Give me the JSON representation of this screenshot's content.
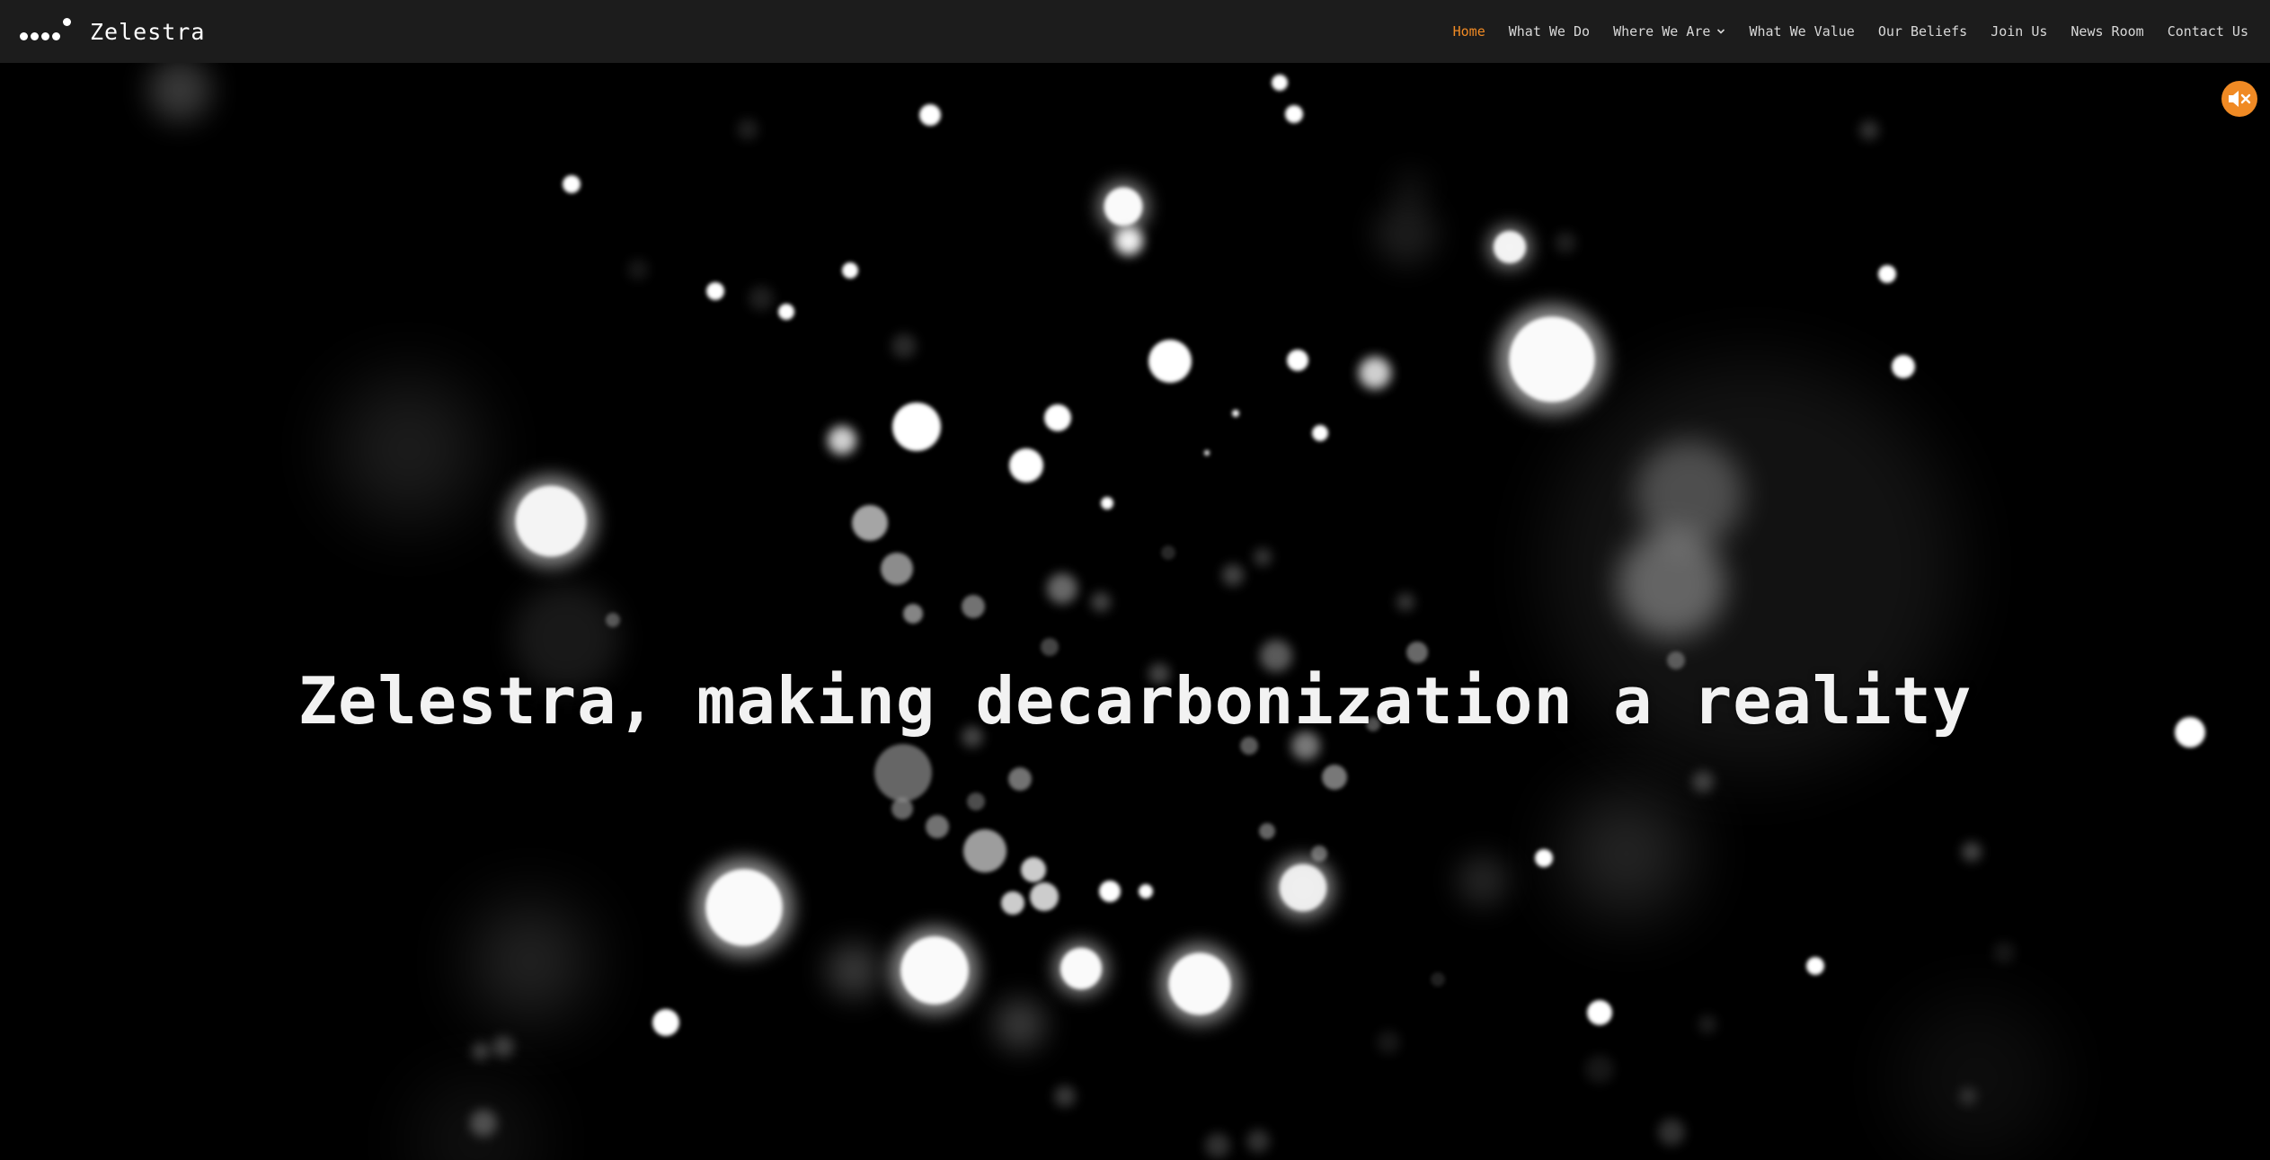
{
  "brand": {
    "name": "Zelestra",
    "logo_icon": "dots-logo-icon"
  },
  "nav": {
    "items": [
      {
        "label": "Home",
        "active": true
      },
      {
        "label": "What We Do",
        "active": false
      },
      {
        "label": "Where We Are",
        "active": false,
        "has_dropdown": true
      },
      {
        "label": "What We Value",
        "active": false
      },
      {
        "label": "Our Beliefs",
        "active": false
      },
      {
        "label": "Join Us",
        "active": false
      },
      {
        "label": "News Room",
        "active": false
      },
      {
        "label": "Contact Us",
        "active": false
      }
    ]
  },
  "hero": {
    "headline": "Zelestra, making decarbonization a reality",
    "background": "bokeh-particles"
  },
  "controls": {
    "mute_icon": "speaker-muted-icon"
  },
  "colors": {
    "accent": "#f08a24",
    "navbar": "#1c1c1c",
    "background": "#000000",
    "nav_text": "#d8d8d8"
  }
}
